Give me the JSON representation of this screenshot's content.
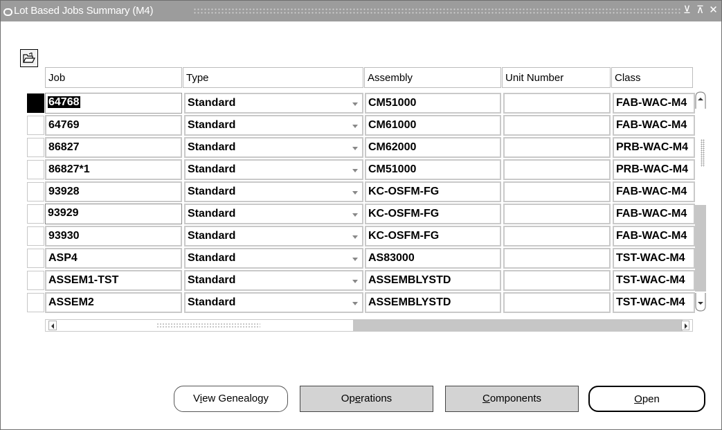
{
  "window": {
    "title": "Lot Based Jobs Summary (M4)",
    "controls": {
      "minimize": "⊻",
      "maximize": "⊼",
      "close": "✕"
    }
  },
  "toolbar": {
    "folder_icon": "folder-open-icon"
  },
  "columns": {
    "job": "Job",
    "type": "Type",
    "assembly": "Assembly",
    "unit_number": "Unit Number",
    "class": "Class"
  },
  "rows": [
    {
      "job": "64768",
      "type": "Standard",
      "assembly": "CM51000",
      "unit_number": "",
      "class": "FAB-WAC-M4"
    },
    {
      "job": "64769",
      "type": "Standard",
      "assembly": "CM61000",
      "unit_number": "",
      "class": "FAB-WAC-M4"
    },
    {
      "job": "86827",
      "type": "Standard",
      "assembly": "CM62000",
      "unit_number": "",
      "class": "PRB-WAC-M4"
    },
    {
      "job": "86827*1",
      "type": "Standard",
      "assembly": "CM51000",
      "unit_number": "",
      "class": "PRB-WAC-M4"
    },
    {
      "job": "93928",
      "type": "Standard",
      "assembly": "KC-OSFM-FG",
      "unit_number": "",
      "class": "FAB-WAC-M4"
    },
    {
      "job": "93929",
      "type": "Standard",
      "assembly": "KC-OSFM-FG",
      "unit_number": "",
      "class": "FAB-WAC-M4"
    },
    {
      "job": "93930",
      "type": "Standard",
      "assembly": "KC-OSFM-FG",
      "unit_number": "",
      "class": "FAB-WAC-M4"
    },
    {
      "job": "ASP4",
      "type": "Standard",
      "assembly": "AS83000",
      "unit_number": "",
      "class": "TST-WAC-M4"
    },
    {
      "job": "ASSEM1-TST",
      "type": "Standard",
      "assembly": "ASSEMBLYSTD",
      "unit_number": "",
      "class": "TST-WAC-M4"
    },
    {
      "job": "ASSEM2",
      "type": "Standard",
      "assembly": "ASSEMBLYSTD",
      "unit_number": "",
      "class": "TST-WAC-M4"
    }
  ],
  "buttons": {
    "view_genealogy": {
      "pre": "V",
      "mnemonic": "i",
      "post": "ew Genealogy"
    },
    "operations": {
      "pre": "Op",
      "mnemonic": "e",
      "post": "rations"
    },
    "components": {
      "pre": "",
      "mnemonic": "C",
      "post": "omponents"
    },
    "open": {
      "pre": "",
      "mnemonic": "O",
      "post": "pen"
    }
  }
}
